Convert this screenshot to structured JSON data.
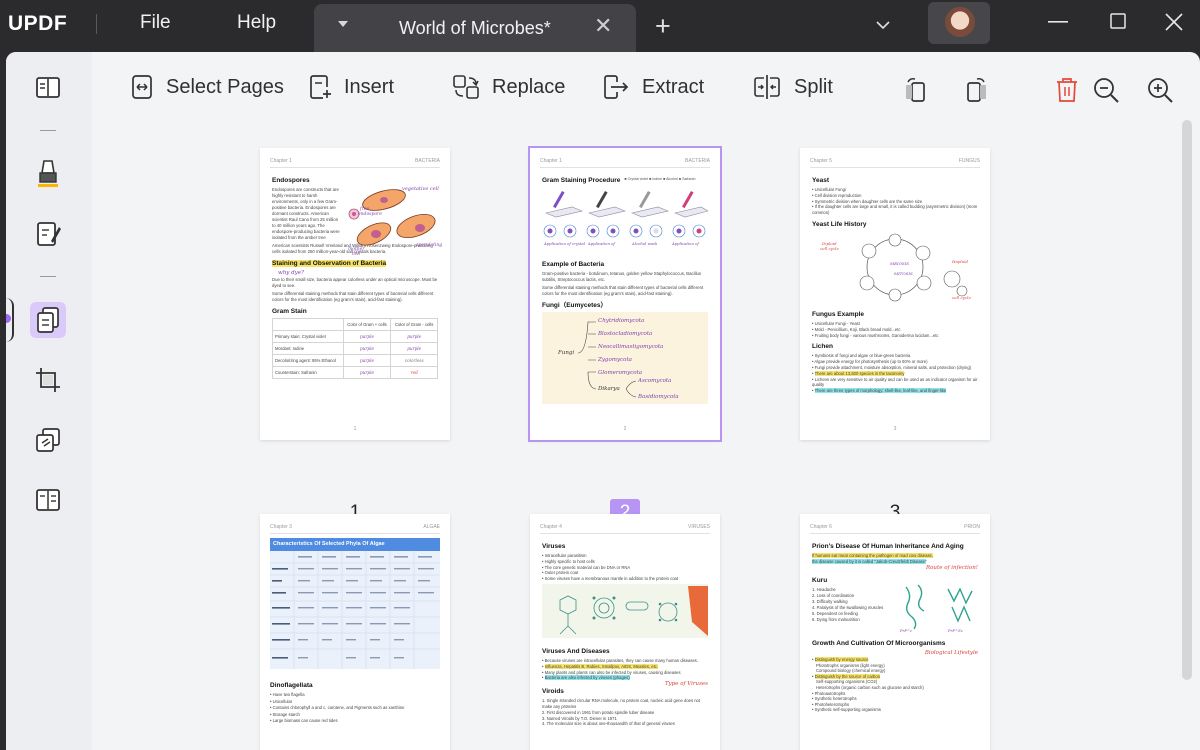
{
  "app": {
    "logo_main": "UPDF",
    "accent": "#ffb400"
  },
  "menu": {
    "file": "File",
    "help": "Help"
  },
  "tab": {
    "title": "World of Microbes*",
    "close": "✕",
    "new_tab": "+"
  },
  "window": {
    "minimize": "—",
    "close": "✕"
  },
  "toolbar": {
    "select_pages": "Select Pages",
    "insert": "Insert",
    "replace": "Replace",
    "extract": "Extract",
    "split": "Split"
  },
  "colors": {
    "selection": "#b895f5",
    "delete": "#e5483b"
  },
  "pages": [
    {
      "num": "1",
      "chapter": "Chapter 1",
      "topic": "BACTERIA",
      "title": "Endospores",
      "para": "Endospores are constructs that are highly resistant to harsh environments, only in a few Gram-positive bacteria. Endospores are dormant constructs. American scientist Raul Cano from 25 million to 40 million years ago. The endospore-producing bacteria were isolated from the amber tree",
      "para2": "American scientists Russell Vreeland and William Rosenzweig Endospore-producing cells isolated from 250 million-year-old salt crystals bacteria.",
      "h2": "Staining and Observation of Bacteria",
      "note": "why dye?",
      "b1": "Due to their small size, bacteria appear colorless under an optical microscope. Must be dyed to see.",
      "b2": "Some differential staining methods that stain different types of bacterial cells different colors for the most identification (eg gram's stain), acid-fast staining).",
      "h3": "Gram Stain",
      "t_col1": "Color of Gram + cells",
      "t_col2": "Color of Gram - cells",
      "rows": [
        [
          "Primary stain: Crystal violet",
          "purple",
          "purple"
        ],
        [
          "Mordant: Iodine",
          "purple",
          "purple"
        ],
        [
          "Decolorizing agent: 95% Ethanol",
          "purple",
          "colorless"
        ],
        [
          "Counterstain: Safranin",
          "purple",
          "red"
        ]
      ],
      "foot": "1"
    },
    {
      "num": "2",
      "chapter": "Chapter 1",
      "topic": "BACTERIA",
      "title": "Gram Staining Procedure",
      "legend": [
        "Crystal violet",
        "Iodine",
        "Alcohol",
        "Safranin"
      ],
      "h2": "Example of Bacteria",
      "b1": "Gram-positive bacteria - botulinum, tetanus, golden yellow Staphylococcus, Bacillus subtilis, Streptococcus lactis, etc.",
      "b2": "Some differential staining methods that stain different types of bacterial cells different colors for the most identification (eg gram's stain), acid-fast staining).",
      "h3": "Fungi（Eumycetes）",
      "fungi_root": "Fungi",
      "fungi_dikarya": "Dikarya",
      "fungi_items": [
        "Chytridiomycota",
        "Blastocladiomycota",
        "Neocallimastigomycota",
        "Zygomycota",
        "Glomeromycota"
      ],
      "fungi_sub": [
        "Ascomycota",
        "Basidiomycota"
      ],
      "foot": "2"
    },
    {
      "num": "3",
      "chapter": "Chapter 5",
      "topic": "FUNGUS",
      "title": "Yeast",
      "list": [
        "Unicellular Fungi",
        "Cell division reproduction",
        "Symmetric division when daughter cells are the same size",
        "If the daughter cells are large and small, it is called budding (asymmetric division) (more common)"
      ],
      "h2": "Yeast Life History",
      "h3": "Fungus Example",
      "list2": [
        "Unicellular Fungi - Yeast",
        "Mold - Penicillium, Koji, Black bread mold...etc",
        "Fruiting body fungi - various mushrooms, Ganoderma lucidum...etc"
      ],
      "h4": "Lichen",
      "list3": [
        "Symbiosis of fungi and algae or blue-green bacteria",
        "Algae provide energy for photosynthesis (up to 60% or more)",
        "Fungi provide attachment, moisture absorption, mineral salts, and protection (drying)",
        "There are about 13,500 species in the taxonomy",
        "Lichens are very sensitive to air quality and can be used as an indicator organism for air quality",
        "There are three types of morphology: shell-like, leaf-like, and finger-like"
      ],
      "foot": "3"
    },
    {
      "chapter": "Chapter 3",
      "topic": "ALGAE",
      "title": "Characteristics Of Selected Phyla Of Algae",
      "h2": "Dinoflagellata",
      "list": [
        "Have two flagella",
        "Unicellular",
        "Contains chlorophyll a and c, carotene, and Pigments such as xanthine",
        "Storage starch",
        "Large biomass can cause red tides"
      ]
    },
    {
      "chapter": "Chapter 4",
      "topic": "VIRUSES",
      "title": "Viruses",
      "list": [
        "Intracellular parasitism",
        "Highly specific to host cells",
        "The core genetic material can be DNA or RNA",
        "Outer protein coat",
        "Some viruses have a membranous mantle in addition to the protein coat"
      ],
      "h2": "Viruses And Diseases",
      "list2": [
        "Because viruses are intracellular parasites, they can cause many human diseases.",
        "Influenza, Hepatitis B, Rabies, Smallpox, AIDS, Measles, etc.",
        "Many plants and plants can also be infected by viruses, causing diseases",
        "Bacteria are also infected by viruses (phages)"
      ],
      "note": "Type of Viruses",
      "h3": "Viroids",
      "list3": [
        "Single stranded circular RNA molecule, no protein coat, nucleic acid gene does not make any proteins",
        "First discovered in 1961 from potato spindle tuber disease",
        "Named Viroids by T.O. Diener in 1971",
        "The molecular size is about one-thousandth of that of general viruses"
      ]
    },
    {
      "chapter": "Chapter 6",
      "topic": "PRION",
      "title": "Prion's Disease Of Human Inheritance And Aging",
      "p1": "If humans eat meat containing the pathogen of mad cow disease,",
      "p2": "the disease caused by it is called \"Jakob-Creutzfeldt Disease\"",
      "note": "Route of infection!",
      "h2": "Kuru",
      "list": [
        "1. Headache",
        "2. Loss of coordination",
        "3. Difficulty walking",
        "4. Paralysis of the swallowing muscles",
        "5. Dependent on feeding",
        "6. Dying from malnutrition"
      ],
      "h3": "Growth And Cultivation Of Microorganisms",
      "note2": "Biological Lifestyle",
      "list2": [
        "Distinguish by energy source",
        "Phototrophs organisms (light energy)",
        "Compound biology (chemical energy)",
        "Distinguish by the source of carbon",
        "Self-supporting organisms (CO2)",
        "Heterotrophs (organic carbon such as glucose and starch)",
        "Photoautotrophs",
        "Synthetic heterotrophs",
        "Photoheterotrophs",
        "Synthetic self-supporting organisms"
      ]
    }
  ]
}
